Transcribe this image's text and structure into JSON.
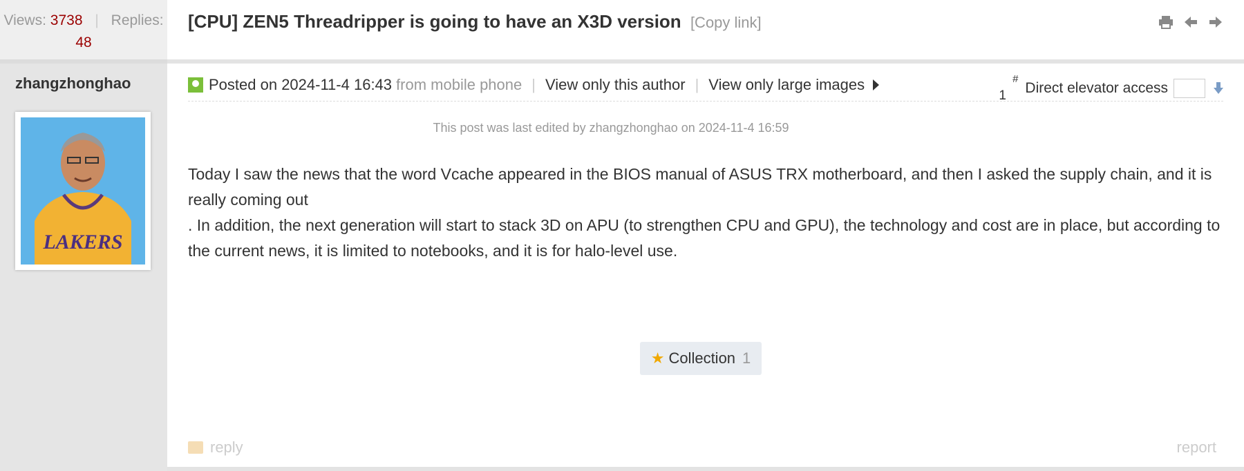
{
  "stats": {
    "views_label": "Views:",
    "views": "3738",
    "replies_label": "Replies:",
    "replies": "48"
  },
  "author": {
    "name": "zhangzhonghao"
  },
  "thread": {
    "title": "[CPU] ZEN5 Threadripper is going to have an X3D version",
    "copy_link": "[Copy link]"
  },
  "title_icons": [
    "print-icon",
    "previous-thread-icon",
    "next-thread-icon"
  ],
  "post": {
    "posted_on": "Posted on 2024-11-4 16:43",
    "source": "from mobile phone",
    "view_author": "View only this author",
    "view_large_images": "View only large images",
    "floor_hash": "#",
    "floor_number": "1",
    "elevator_label": "Direct elevator access",
    "edit_note": "This post was last edited by zhangzhonghao on 2024-11-4 16:59",
    "body_line1": "Today I saw the news that the word Vcache appeared in the BIOS manual of ASUS TRX motherboard, and then I asked the supply chain, and it is really coming out",
    "body_line2": ". In addition, the next generation will start to stack 3D on APU (to strengthen CPU and GPU), the technology and cost are in place, but according to the current news, it is limited to notebooks, and it is for halo-level use."
  },
  "collection": {
    "label": "Collection",
    "count": "1"
  },
  "footer": {
    "reply": "reply",
    "report": "report"
  },
  "colors": {
    "number_red": "#9b0000",
    "muted": "#999999",
    "star": "#f0a800",
    "poster_green": "#7bbf3a"
  }
}
